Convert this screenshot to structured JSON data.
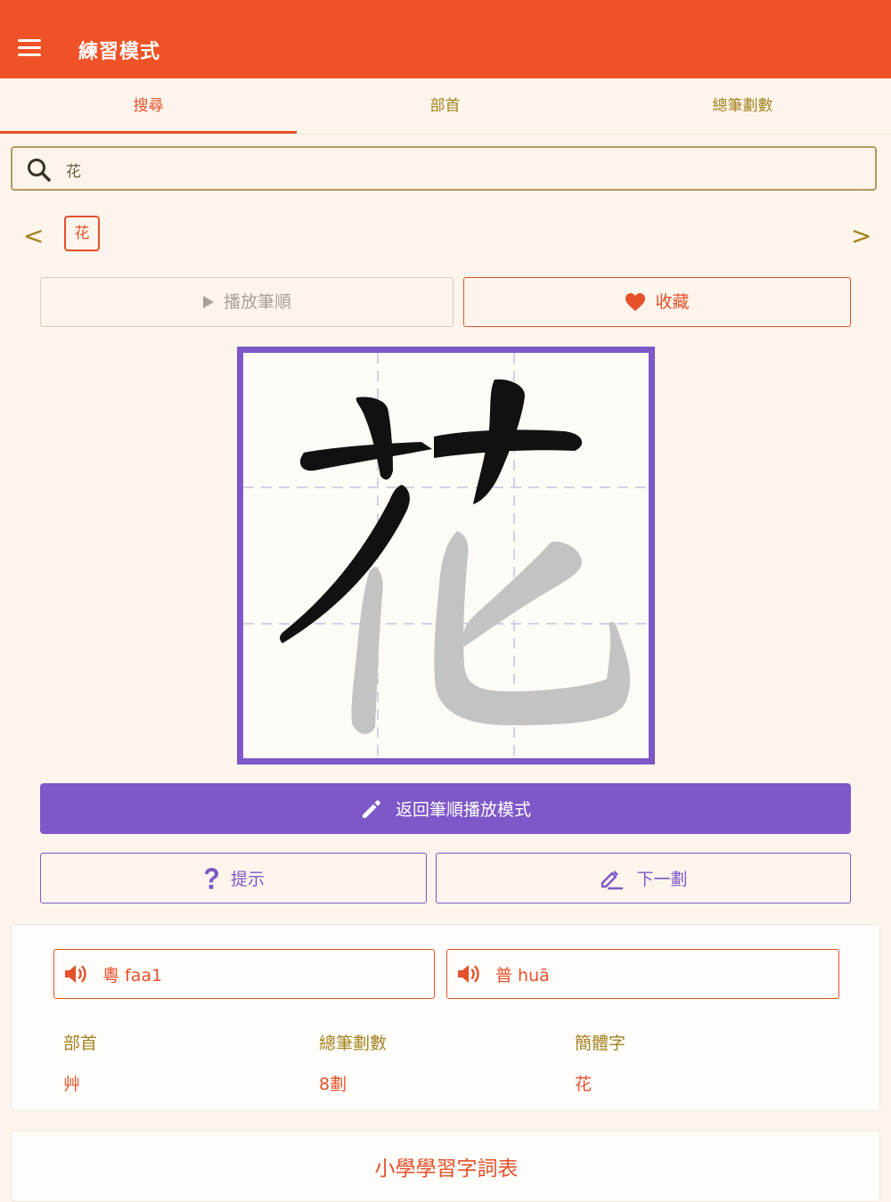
{
  "appbar": {
    "title": "練習模式"
  },
  "tabs": [
    {
      "label": "搜尋",
      "active": true
    },
    {
      "label": "部首",
      "active": false
    },
    {
      "label": "總筆劃數",
      "active": false
    }
  ],
  "search": {
    "value": "花"
  },
  "navigator": {
    "prev": "<",
    "next": ">",
    "current_char": "花"
  },
  "actions": {
    "play_label": "播放筆順",
    "favorite_label": "收藏"
  },
  "practice": {
    "return_label": "返回筆順播放模式",
    "hint_label": "提示",
    "next_stroke_label": "下一劃"
  },
  "pronunciation": {
    "cantonese": "粵 faa1",
    "mandarin": "普 huā"
  },
  "info": {
    "radical_label": "部首",
    "radical_value": "艸",
    "strokes_label": "總筆劃數",
    "strokes_value": "8劃",
    "simplified_label": "簡體字",
    "simplified_value": "花"
  },
  "word_list": {
    "title": "小學學習字詞表"
  },
  "colors": {
    "appbar": "#f05227",
    "accent": "#e4512a",
    "purple": "#7e57c8",
    "gold": "#a4811f",
    "background": "#fdf5ec"
  }
}
